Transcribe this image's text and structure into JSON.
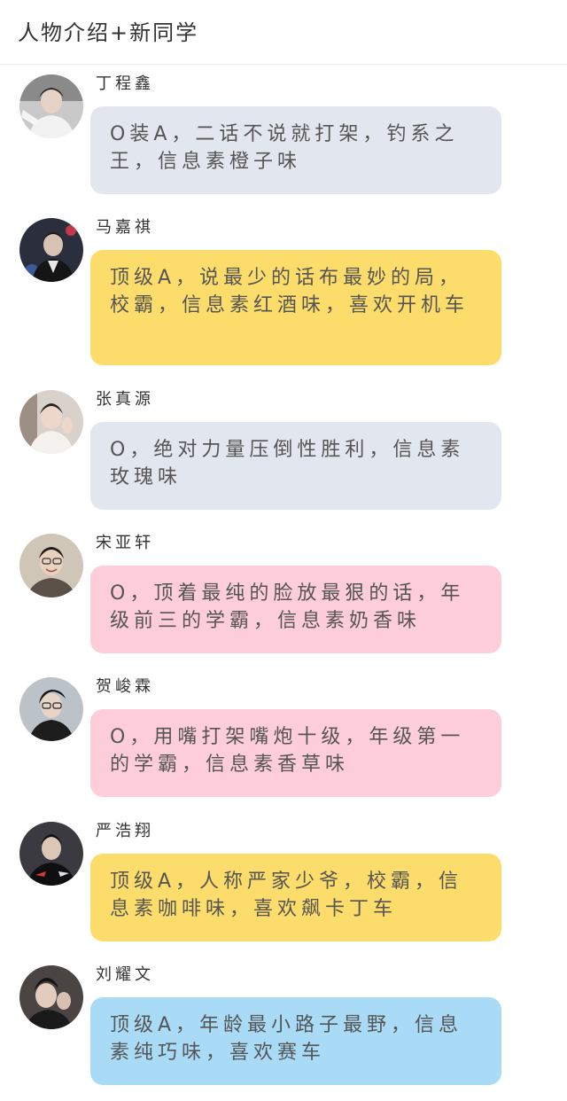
{
  "header": {
    "title": "人物介绍+新同学"
  },
  "messages": [
    {
      "name": "丁程鑫",
      "text": "O装A，二话不说就打架，钓系之王，信息素橙子味",
      "bubble_color": "#e2e6ee",
      "avatar_icon": "avatar-photo"
    },
    {
      "name": "马嘉祺",
      "text": "顶级A，说最少的话布最妙的局，校霸，信息素红酒味，喜欢开机车",
      "bubble_color": "#fcdc6b",
      "avatar_icon": "avatar-photo"
    },
    {
      "name": "张真源",
      "text": "O，绝对力量压倒性胜利，信息素玫瑰味",
      "bubble_color": "#e2e6ee",
      "avatar_icon": "avatar-photo"
    },
    {
      "name": "宋亚轩",
      "text": "O，顶着最纯的脸放最狠的话，年级前三的学霸，信息素奶香味",
      "bubble_color": "#fdcdda",
      "avatar_icon": "avatar-photo"
    },
    {
      "name": "贺峻霖",
      "text": "O，用嘴打架嘴炮十级，年级第一的学霸，信息素香草味",
      "bubble_color": "#fdcdda",
      "avatar_icon": "avatar-photo"
    },
    {
      "name": "严浩翔",
      "text": "顶级A，人称严家少爷，校霸，信息素咖啡味，喜欢飙卡丁车",
      "bubble_color": "#fcdc6b",
      "avatar_icon": "avatar-photo"
    },
    {
      "name": "刘耀文",
      "text": "顶级A，年龄最小路子最野，信息素纯巧味，喜欢赛车",
      "bubble_color": "#a9dbf6",
      "avatar_icon": "avatar-photo"
    }
  ]
}
